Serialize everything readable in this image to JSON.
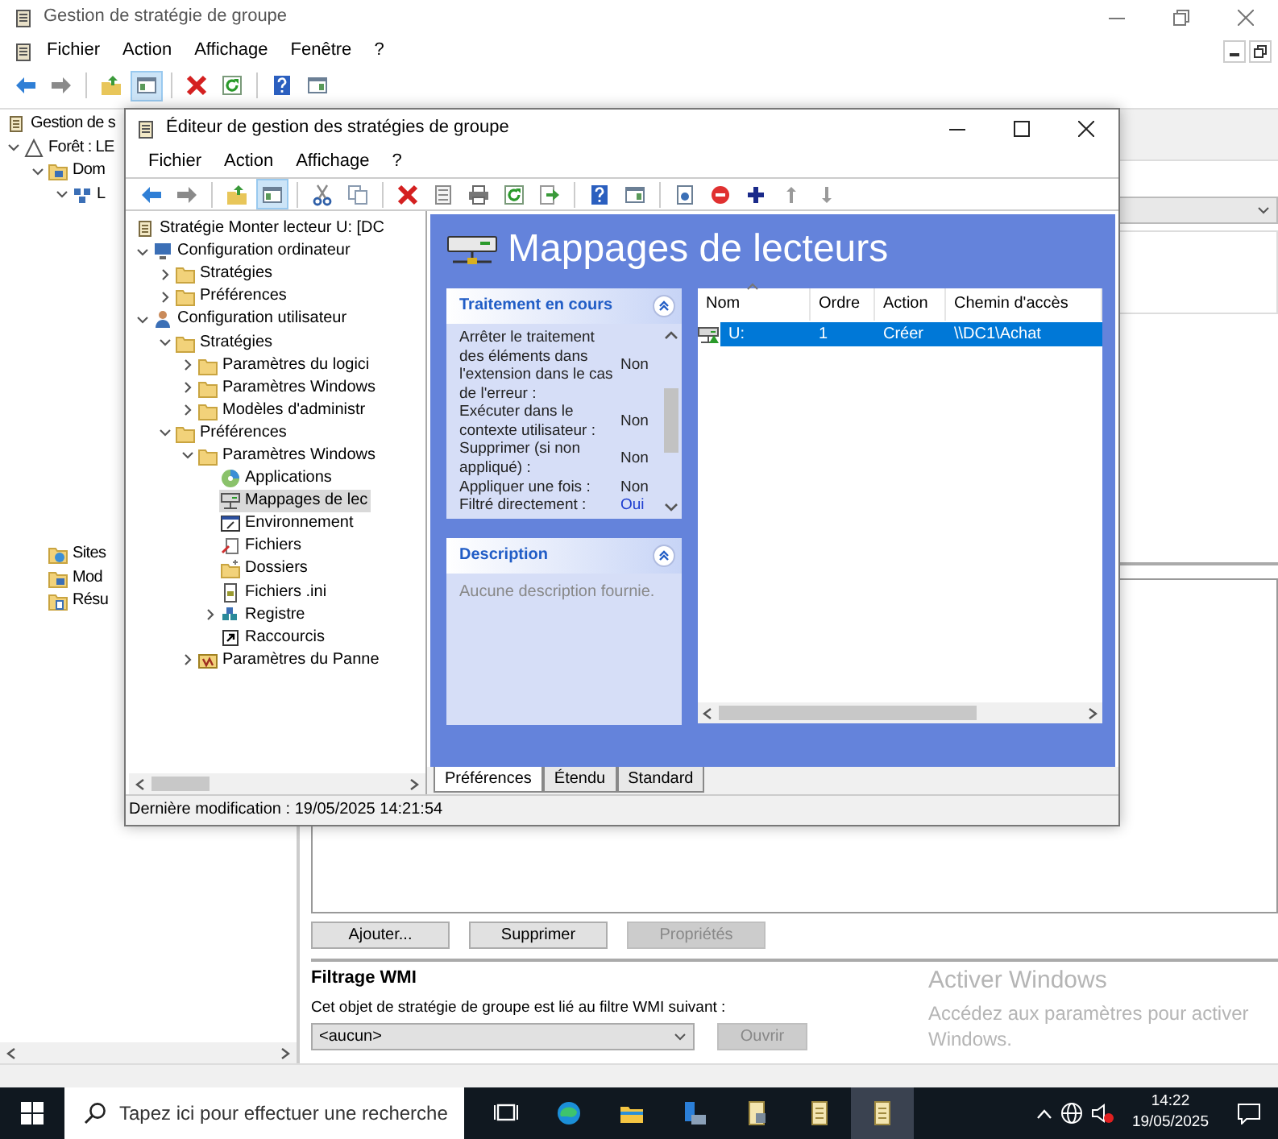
{
  "main_window": {
    "title": "Gestion de stratégie de groupe",
    "menu": [
      "Fichier",
      "Action",
      "Affichage",
      "Fenêtre",
      "?"
    ],
    "toolbar": [
      {
        "kind": "back",
        "pressed": false
      },
      {
        "kind": "forward",
        "pressed": false
      },
      {
        "kind": "separator"
      },
      {
        "kind": "folder-up",
        "pressed": false
      },
      {
        "kind": "tree",
        "pressed": true
      },
      {
        "kind": "separator"
      },
      {
        "kind": "delete",
        "pressed": false
      },
      {
        "kind": "refresh",
        "pressed": false
      },
      {
        "kind": "separator"
      },
      {
        "kind": "help",
        "pressed": false
      },
      {
        "kind": "panel",
        "pressed": false
      }
    ],
    "tree": [
      {
        "label": "Gestion de s",
        "kind": "gpm",
        "children": [
          {
            "label": "Forêt : LE",
            "kind": "forest",
            "expanded": true,
            "children": [
              {
                "label": "Dom",
                "kind": "domains",
                "expanded": true,
                "children": [
                  {
                    "label": "L",
                    "kind": "domain",
                    "expanded": true
                  }
                ]
              },
              {
                "label": "Sites",
                "kind": "sites"
              },
              {
                "label": "Mod",
                "kind": "modeling"
              },
              {
                "label": "Résu",
                "kind": "results"
              }
            ]
          }
        ]
      }
    ],
    "buttons": [
      {
        "label": "Ajouter...",
        "disabled": false
      },
      {
        "label": "Supprimer",
        "disabled": false
      },
      {
        "label": "Propriétés",
        "disabled": true
      }
    ],
    "wmi": {
      "title": "Filtrage WMI",
      "text": "Cet objet de stratégie de groupe est lié au filtre WMI suivant :",
      "value": "<aucun>",
      "button": {
        "label": "Ouvrir",
        "disabled": true
      }
    },
    "activation": {
      "title": "Activer Windows",
      "text": "Accédez aux paramètres pour activer Windows."
    }
  },
  "editor": {
    "title": "Éditeur de gestion des stratégies de groupe",
    "menu": [
      "Fichier",
      "Action",
      "Affichage",
      "?"
    ],
    "toolbar": [
      {
        "kind": "back",
        "pressed": false
      },
      {
        "kind": "forward",
        "pressed": false
      },
      {
        "kind": "separator"
      },
      {
        "kind": "folder-up",
        "pressed": false
      },
      {
        "kind": "tree",
        "pressed": true
      },
      {
        "kind": "separator"
      },
      {
        "kind": "cut",
        "pressed": false
      },
      {
        "kind": "copy",
        "pressed": false
      },
      {
        "kind": "separator"
      },
      {
        "kind": "delete",
        "pressed": false
      },
      {
        "kind": "properties",
        "pressed": false
      },
      {
        "kind": "print",
        "pressed": false
      },
      {
        "kind": "refresh",
        "pressed": false
      },
      {
        "kind": "export",
        "pressed": false
      },
      {
        "kind": "separator"
      },
      {
        "kind": "help",
        "pressed": false
      },
      {
        "kind": "panel",
        "pressed": false
      },
      {
        "kind": "separator"
      },
      {
        "kind": "page",
        "pressed": false
      },
      {
        "kind": "stop",
        "pressed": false
      },
      {
        "kind": "add",
        "pressed": false
      },
      {
        "kind": "up",
        "pressed": false
      },
      {
        "kind": "down",
        "pressed": false
      }
    ],
    "tree": [
      {
        "label": "Stratégie Monter lecteur U: [DC",
        "kind": "policy",
        "selected": false,
        "children": [
          {
            "label": "Configuration ordinateur",
            "kind": "computer",
            "expanded": true,
            "selected": false,
            "children": [
              {
                "label": "Stratégies",
                "kind": "folder",
                "expanded": false,
                "selected": false
              },
              {
                "label": "Préférences",
                "kind": "folder",
                "expanded": false,
                "selected": false
              }
            ]
          },
          {
            "label": "Configuration utilisateur",
            "kind": "user",
            "expanded": true,
            "selected": false,
            "children": [
              {
                "label": "Stratégies",
                "kind": "folder",
                "expanded": true,
                "selected": false,
                "children": [
                  {
                    "label": "Paramètres du logici",
                    "kind": "folder",
                    "expanded": false,
                    "selected": false
                  },
                  {
                    "label": "Paramètres Windows",
                    "kind": "folder",
                    "expanded": false,
                    "selected": false
                  },
                  {
                    "label": "Modèles d'administr",
                    "kind": "folder",
                    "expanded": false,
                    "selected": false
                  }
                ]
              },
              {
                "label": "Préférences",
                "kind": "folder",
                "expanded": true,
                "selected": false,
                "children": [
                  {
                    "label": "Paramètres Windows",
                    "kind": "folder",
                    "expanded": true,
                    "selected": false,
                    "children": [
                      {
                        "label": "Applications",
                        "kind": "apps",
                        "selected": false
                      },
                      {
                        "label": "Mappages de lec",
                        "kind": "drive",
                        "selected": true
                      },
                      {
                        "label": "Environnement",
                        "kind": "env",
                        "selected": false
                      },
                      {
                        "label": "Fichiers",
                        "kind": "files",
                        "selected": false
                      },
                      {
                        "label": "Dossiers",
                        "kind": "folders",
                        "selected": false
                      },
                      {
                        "label": "Fichiers .ini",
                        "kind": "ini",
                        "selected": false
                      },
                      {
                        "label": "Registre",
                        "kind": "registry",
                        "expanded": false,
                        "selected": false
                      },
                      {
                        "label": "Raccourcis",
                        "kind": "shortcut",
                        "selected": false
                      }
                    ]
                  },
                  {
                    "label": "Paramètres du Panne",
                    "kind": "cpanel",
                    "expanded": false,
                    "selected": false
                  }
                ]
              }
            ]
          }
        ]
      }
    ],
    "heading": "Mappages de lecteurs",
    "processing": {
      "title": "Traitement en cours",
      "rows": [
        {
          "label": "Arrêter le traitement des éléments dans l'extension dans le cas de l'erreur :",
          "value": "Non",
          "link": false
        },
        {
          "label": "Exécuter dans le contexte utilisateur :",
          "value": "Non",
          "link": false
        },
        {
          "label": "Supprimer (si non appliqué) :",
          "value": "Non",
          "link": false
        },
        {
          "label": "Appliquer une fois :",
          "value": "Non",
          "link": false
        },
        {
          "label": "Filtré directement :",
          "value": "Oui",
          "link": true
        }
      ]
    },
    "description": {
      "title": "Description",
      "text": "Aucune description fournie."
    },
    "table": {
      "columns": [
        {
          "label": "Nom",
          "sorted": true
        },
        {
          "label": "Ordre",
          "sorted": false
        },
        {
          "label": "Action",
          "sorted": false
        },
        {
          "label": "Chemin d'accès",
          "sorted": false
        }
      ],
      "rows": [
        {
          "cells": [
            "U:",
            "1",
            "Créer",
            "\\\\DC1\\Achat"
          ],
          "selected": true
        }
      ]
    },
    "tabs": [
      {
        "label": "Préférences",
        "selected": true
      },
      {
        "label": "Étendu",
        "selected": false
      },
      {
        "label": "Standard",
        "selected": false
      }
    ],
    "status": "Dernière modification : 19/05/2025 14:21:54"
  },
  "taskbar": {
    "search_placeholder": "Tapez ici pour effectuer une recherche",
    "apps": [
      {
        "kind": "task-view",
        "active": false
      },
      {
        "kind": "browser",
        "active": false
      },
      {
        "kind": "explorer",
        "active": false
      },
      {
        "kind": "server",
        "active": false
      },
      {
        "kind": "gpm",
        "active": false
      },
      {
        "kind": "scroll",
        "active": false
      },
      {
        "kind": "scroll",
        "active": true
      }
    ],
    "time": "14:22",
    "date": "19/05/2025"
  }
}
